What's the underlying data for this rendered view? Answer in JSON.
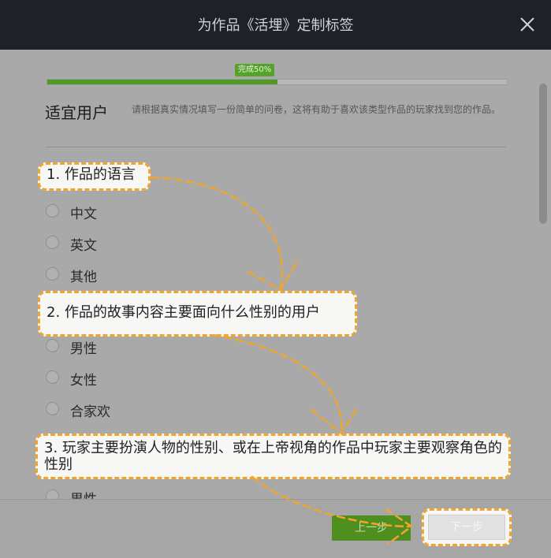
{
  "dialog": {
    "title": "为作品《活埋》定制标签"
  },
  "progress": {
    "label": "完成50%",
    "value": 0.5
  },
  "section": {
    "title": "适宜用户",
    "description": "请根据真实情况填写一份简单的问卷，这将有助于喜欢该类型作品的玩家找到您的作品。"
  },
  "questions": [
    {
      "label": "1. 作品的语言",
      "options": [
        "中文",
        "英文",
        "其他"
      ]
    },
    {
      "label": "2. 作品的故事内容主要面向什么性别的用户",
      "options": [
        "男性",
        "女性",
        "合家欢"
      ]
    },
    {
      "label": "3. 玩家主要扮演人物的性别、或在上帝视角的作品中玩家主要观察角色的性别",
      "options": [
        "男性"
      ]
    }
  ],
  "footer": {
    "prev_label": "上一步",
    "next_label": "下一步"
  },
  "colors": {
    "accent_green": "#55a32a",
    "annotation_orange": "#f0a52c",
    "titlebar": "#1f2128"
  },
  "icons": {
    "close": "close-icon"
  }
}
